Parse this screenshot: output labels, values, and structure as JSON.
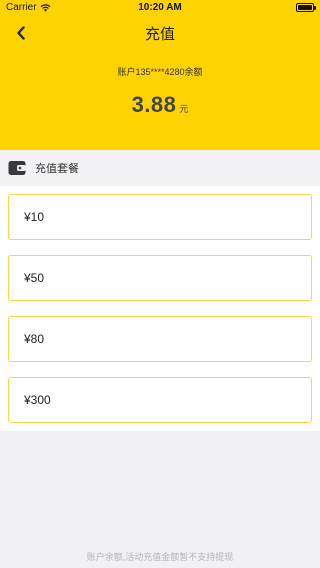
{
  "status_bar": {
    "carrier": "Carrier",
    "time": "10:20 AM"
  },
  "nav": {
    "title": "充值",
    "back_icon": "chevron-left-icon"
  },
  "account": {
    "label": "账户135****4280余额"
  },
  "balance": {
    "amount": "3.88",
    "unit": "元"
  },
  "section": {
    "title": "充值套餐",
    "icon": "wallet-icon"
  },
  "plans": [
    {
      "label": "¥10"
    },
    {
      "label": "¥50"
    },
    {
      "label": "¥80"
    },
    {
      "label": "¥300"
    }
  ],
  "footer": {
    "note": "账户余额,活动充值金额暂不支持提现"
  },
  "colors": {
    "accent": "#ffd300",
    "plan_border": "#ffd24a",
    "page_bg": "#f1f1f3"
  }
}
